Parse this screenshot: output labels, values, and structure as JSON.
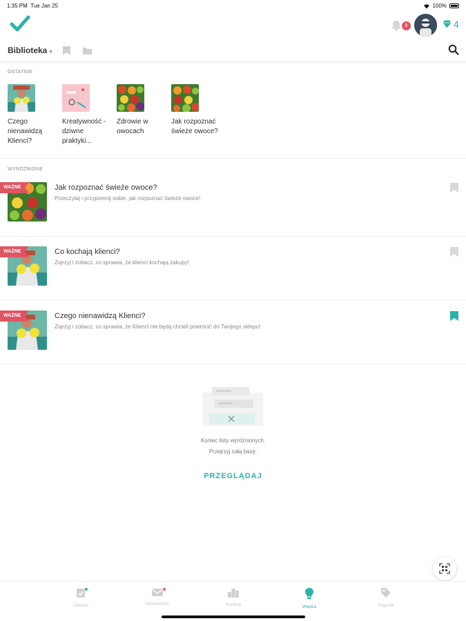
{
  "status_bar": {
    "time": "1:35 PM",
    "date": "Tue Jan 25",
    "battery": "100%"
  },
  "header": {
    "notification_count": "8",
    "gems_count": "4",
    "accent_color": "#2bb3a8",
    "alert_color": "#e05563"
  },
  "library": {
    "title": "Biblioteka"
  },
  "recent": {
    "label": "OSTATNIE",
    "items": [
      {
        "title": "Czego nienawidzą Klienci?"
      },
      {
        "title": "Kreatywność - dziwne praktyki..."
      },
      {
        "title": "Zdrowie w owocach"
      },
      {
        "title": "Jak rozpoznać świeże owoce?"
      }
    ]
  },
  "featured": {
    "label": "WYRÓŻNIONE",
    "badge": "WAŻNE",
    "items": [
      {
        "title": "Jak rozpoznać świeże owoce?",
        "desc": "Przeczytaj i przypomnij sobie, jak rozpoznać świeże owoce!",
        "bookmarked": false
      },
      {
        "title": "Co kochają klienci?",
        "desc": "Zajrzyj i zobacz, co sprawia, że klienci kochają zakupy!",
        "bookmarked": false
      },
      {
        "title": "Czego nienawidzą Klienci?",
        "desc": "Zajrzyj i zobacz, co sprawia, że Klienci nie będą chcieli powrócić do Twojego sklepu!",
        "bookmarked": true
      }
    ]
  },
  "empty_state": {
    "line1": "Koniec listy wyróżnionych.",
    "line2": "Przejrzyj całą bazę.",
    "button": "PRZEGLĄDAJ"
  },
  "nav": {
    "items": [
      {
        "label": "Zadania"
      },
      {
        "label": "Wiadomości"
      },
      {
        "label": "Ranking"
      },
      {
        "label": "Wiedza"
      },
      {
        "label": "Sugestie"
      }
    ]
  }
}
